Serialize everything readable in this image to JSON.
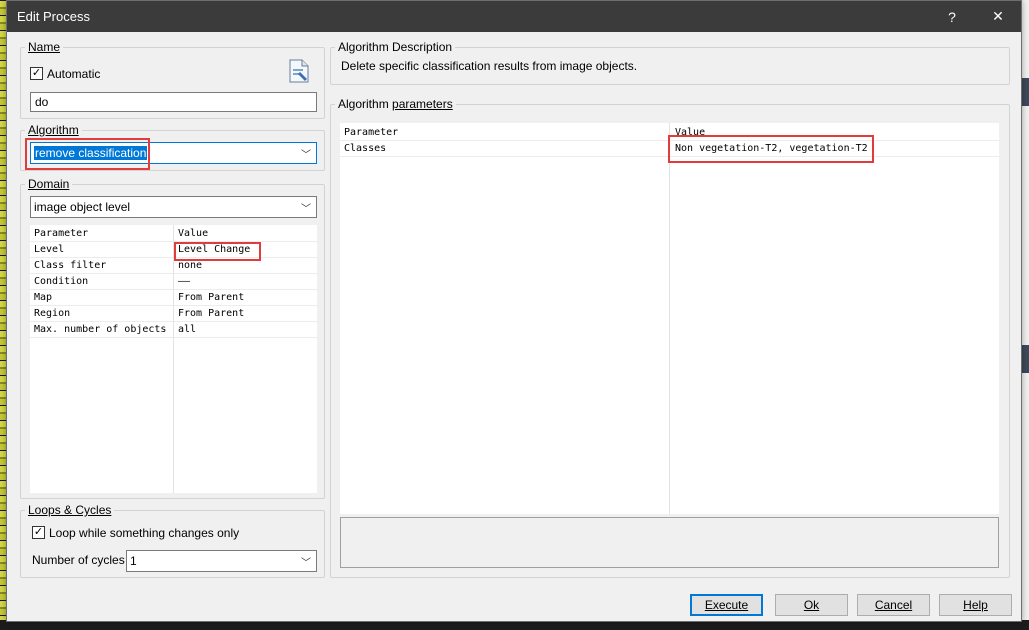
{
  "dialog": {
    "title": "Edit Process",
    "help_glyph": "?",
    "close_glyph": "✕"
  },
  "name_group": {
    "legend": "Name",
    "automatic_label": "Automatic",
    "automatic_checked": true,
    "name_value": "do",
    "icon": "process-document-icon"
  },
  "algorithm_group": {
    "legend": "Algorithm",
    "selected": "remove classification"
  },
  "domain_group": {
    "legend": "Domain",
    "selected": "image object level",
    "header": {
      "parameter": "Parameter",
      "value": "Value"
    },
    "rows": [
      {
        "parameter": "Level",
        "value": "Level Change"
      },
      {
        "parameter": "Class filter",
        "value": "none"
      },
      {
        "parameter": "Condition",
        "value": "——"
      },
      {
        "parameter": "Map",
        "value": "From Parent"
      },
      {
        "parameter": "Region",
        "value": "From Parent"
      },
      {
        "parameter": "Max. number of objects",
        "value": "all"
      }
    ]
  },
  "loops_group": {
    "legend": "Loops & Cycles",
    "loop_label": "Loop while something changes only",
    "loop_checked": true,
    "cycles_label": "Number of cycles",
    "cycles_value": "1"
  },
  "description_group": {
    "legend": "Algorithm Description",
    "text": "Delete specific classification results from image objects."
  },
  "parameters_group": {
    "legend": "Algorithm parameters",
    "header": {
      "parameter": "Parameter",
      "value": "Value"
    },
    "rows": [
      {
        "parameter": "Classes",
        "value": "Non vegetation-T2, vegetation-T2"
      }
    ]
  },
  "buttons": {
    "execute": "Execute",
    "ok": "Ok",
    "cancel": "Cancel",
    "help": "Help"
  },
  "colors": {
    "highlight_box": "#e23b3b",
    "selection": "#0078d7",
    "titlebar": "#3b3b3b"
  }
}
